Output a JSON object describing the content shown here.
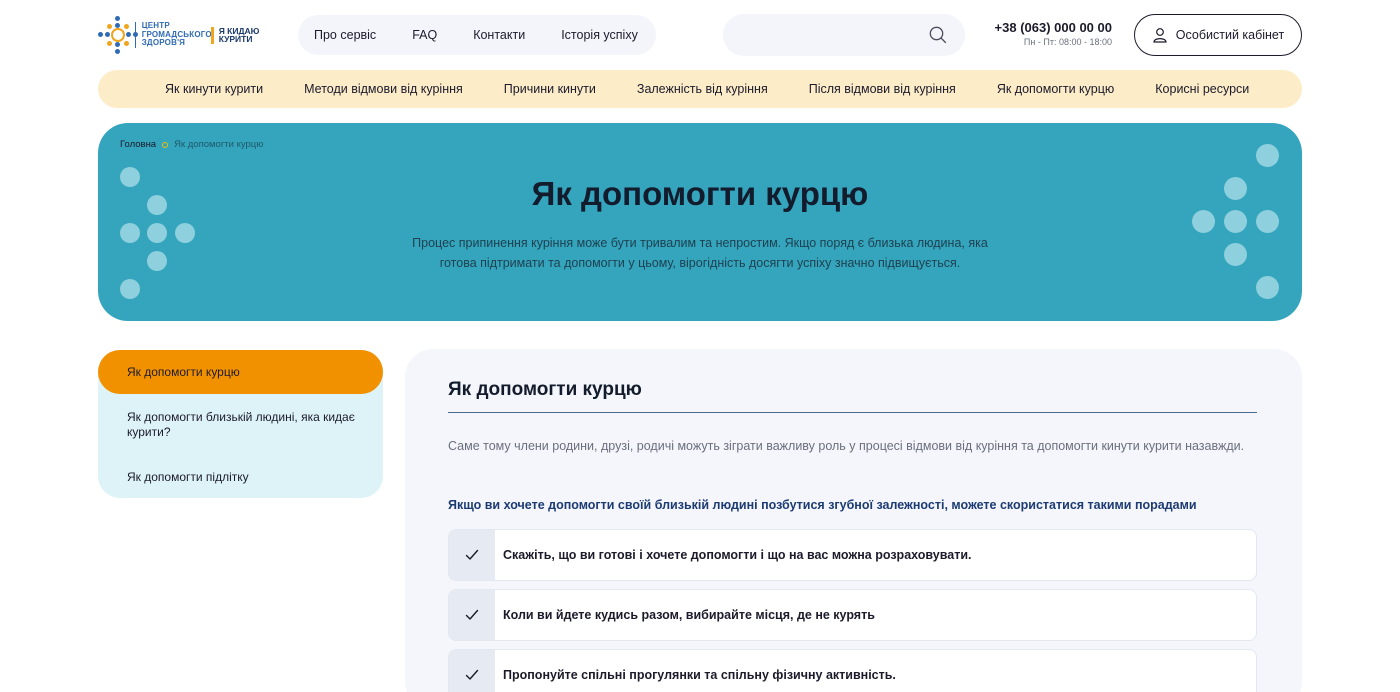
{
  "logo": {
    "org_text": "ЦЕНТР ГРОМАДСЬКОГО ЗДОРОВ'Я",
    "brand_text": "Я КИДАЮ КУРИТИ"
  },
  "topnav": {
    "items": [
      "Про сервіс",
      "FAQ",
      "Контакти",
      "Історія успіху"
    ]
  },
  "search": {
    "placeholder": "",
    "icon": "search-icon"
  },
  "contact": {
    "phone": "+38 (063) 000 00 00",
    "hours": "Пн - Пт: 08:00 - 18:00"
  },
  "cabinet": {
    "label": "Особистий кабінет",
    "icon": "user-icon"
  },
  "subnav": {
    "items": [
      "Як кинути курити",
      "Методи відмови від куріння",
      "Причини кинути",
      "Залежність від куріння",
      "Після відмови від куріння",
      "Як допомогти курцю",
      "Корисні ресурси"
    ]
  },
  "hero": {
    "breadcrumb": {
      "home": "Головна",
      "current": "Як допомогти курцю"
    },
    "title": "Як допомогти курцю",
    "description": "Процес припинення куріння може бути тривалим та непростим. Якщо поряд є близька людина, яка готова підтримати та допомогти у цьому, вірогідність досягти успіху значно підвищується."
  },
  "sidebar": {
    "active": "Як допомогти курцю",
    "items": [
      "Як допомогти близькій людині, яка кидає курити?",
      "Як допомогти підлітку"
    ]
  },
  "main": {
    "title": "Як допомогти курцю",
    "lead": "Саме тому члени родини, друзі, родичі можуть зіграти важливу роль у процесі відмови від куріння та допомогти кинути курити назавжди.",
    "subhead": "Якщо ви хочете допомогти своїй близькій людині позбутися згубної залежності, можете скористатися такими порадами",
    "tips": [
      "Скажіть, що ви готові і хочете допомогти і що на вас можна розраховувати.",
      "Коли ви йдете кудись разом, вибирайте місця, де не курять",
      "Пропонуйте спільні прогулянки та спільну фізичну активність."
    ]
  },
  "colors": {
    "hero_bg": "#35a4bd",
    "subnav_bg": "#fdecc8",
    "sidebar_active": "#f29100",
    "sidebar_bg": "#def3f8",
    "subhead": "#1c3b73"
  }
}
